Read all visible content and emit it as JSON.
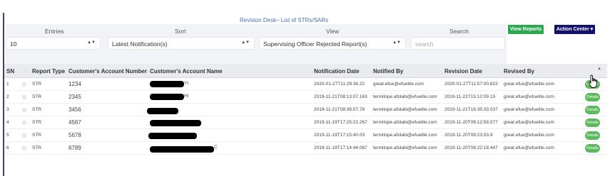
{
  "title": "Revision Desk– List of STRs/SARs",
  "filters": {
    "entries_label": "Entries",
    "entries_value": "10",
    "sort_label": "Sort",
    "sort_value": "Latest Notification(s)",
    "view_label": "View",
    "view_value": "Supervising Officer Rejected Report(s)",
    "search_label": "Search",
    "search_placeholder": "search"
  },
  "buttons": {
    "view_reports": "View Reports",
    "action_center": "Action Center ▾"
  },
  "table": {
    "headers": {
      "sn": "SN",
      "report_type": "Report Type",
      "account_number": "Customer's Account Number",
      "account_name": "Customer's Account Name",
      "notification_date": "Notification Date",
      "notified_by": "Notified By",
      "revision_date": "Revision Date",
      "revised_by": "Revised By"
    },
    "rows": [
      {
        "sn": "1",
        "type": "STR",
        "account": "1234",
        "name_tail": "YI",
        "notified_date": "2020-01-27T11:29:36.22",
        "notified_by": "great.efue@efuelite.com",
        "revision_date": "2020-01-27T11:57:00.823",
        "revised_by": "great.efue@efuelite.com",
        "action": "Details"
      },
      {
        "sn": "2",
        "type": "STR",
        "account": "2345",
        "name_tail": "HI",
        "notified_date": "2019-11-21T08:13:07.163",
        "notified_by": "termitope.afolabi@efuelite.com",
        "revision_date": "2019-11-22T15:12:09.15",
        "revised_by": "great.efue@efuelite.com",
        "action": "Details"
      },
      {
        "sn": "3",
        "type": "STR",
        "account": "3456",
        "name_tail": "",
        "notified_date": "2019-11-21T08:36:07.78",
        "notified_by": "termitope.afolabi@efuelite.com",
        "revision_date": "2019-11-21T16:35:33.037",
        "revised_by": "great.efue@efuelite.com",
        "action": "Details"
      },
      {
        "sn": "4",
        "type": "STR",
        "account": "4567",
        "name_tail": "",
        "notified_date": "2019-11-19T17:25:21.267",
        "notified_by": "termitope.afolabi@efuelite.com",
        "revision_date": "2019-11-20T08:12:58.577",
        "revised_by": "great.efue@efuelite.com",
        "action": "Details"
      },
      {
        "sn": "5",
        "type": "STR",
        "account": "5678",
        "name_tail": "",
        "notified_date": "2019-11-19T17:15:40.03",
        "notified_by": "termitope.afolabi@efuelite.com",
        "revision_date": "2019-11-20T08:23:33.9",
        "revised_by": "great.efue@efuelite.com",
        "action": "Details"
      },
      {
        "sn": "6",
        "type": "STR",
        "account": "6789",
        "name_tail": "C",
        "notified_date": "2019-11-19T17:14:44.087",
        "notified_by": "termitope.afolabi@efuelite.com",
        "revision_date": "2019-11-20T08:22:18.447",
        "revised_by": "great.efue@efuelite.com",
        "action": "Details"
      }
    ]
  },
  "colors": {
    "accent_border": "#3d3f7a",
    "title_blue": "#4a6fb0",
    "view_reports_green": "#2ea84f",
    "action_center_navy": "#12126e",
    "details_green": "#5cb85c"
  }
}
